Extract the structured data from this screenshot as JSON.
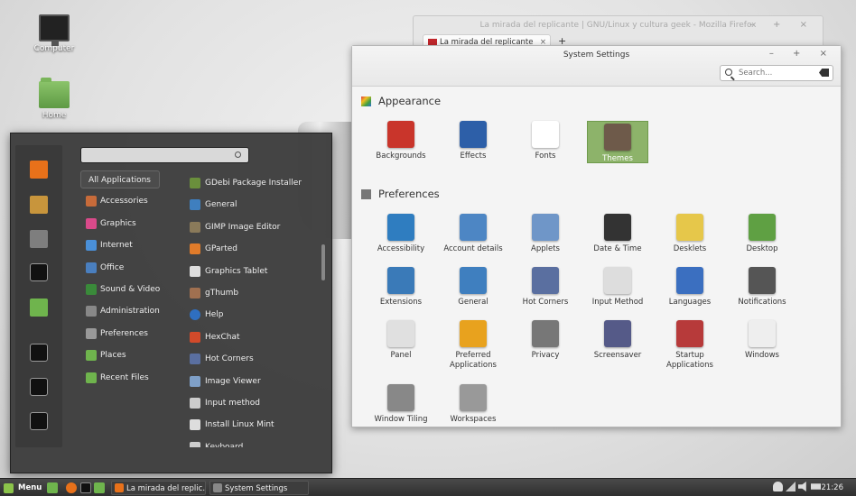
{
  "desktop": {
    "icons": [
      {
        "label": "Computer",
        "icon": "monitor-icon"
      },
      {
        "label": "Home",
        "icon": "home-folder-icon"
      }
    ]
  },
  "firefox": {
    "title": "La mirada del replicante | GNU/Linux y cultura geek - Mozilla Firefox",
    "tab_label": "La mirada del replicante",
    "tab_close": "×",
    "new_tab": "+",
    "controls": "– + ×"
  },
  "settings": {
    "title": "System Settings",
    "controls": "– + ×",
    "search": {
      "placeholder": "Search..."
    },
    "sections": [
      {
        "title": "Appearance",
        "items": [
          {
            "label": "Backgrounds",
            "icon": "backgrounds-icon",
            "color": "#c9352b"
          },
          {
            "label": "Effects",
            "icon": "effects-icon",
            "color": "#2d5fa8"
          },
          {
            "label": "Fonts",
            "icon": "fonts-icon",
            "color": "#ffffff"
          },
          {
            "label": "Themes",
            "icon": "themes-icon",
            "color": "#6e5a4a",
            "selected": true
          }
        ]
      },
      {
        "title": "Preferences",
        "items": [
          {
            "label": "Accessibility",
            "icon": "accessibility-icon",
            "color": "#2f7dc0"
          },
          {
            "label": "Account details",
            "icon": "account-icon",
            "color": "#4d86c4"
          },
          {
            "label": "Applets",
            "icon": "applets-icon",
            "color": "#6f96c8"
          },
          {
            "label": "Date & Time",
            "icon": "clock-icon",
            "color": "#333333"
          },
          {
            "label": "Desklets",
            "icon": "desklets-icon",
            "color": "#e6c74a"
          },
          {
            "label": "Desktop",
            "icon": "desktop-icon",
            "color": "#5fa043"
          },
          {
            "label": "Extensions",
            "icon": "extensions-icon",
            "color": "#3a7ab8"
          },
          {
            "label": "General",
            "icon": "general-icon",
            "color": "#3f7fbf"
          },
          {
            "label": "Hot Corners",
            "icon": "hot-corners-icon",
            "color": "#5a6fa0"
          },
          {
            "label": "Input Method",
            "icon": "keyboard-icon",
            "color": "#dddddd"
          },
          {
            "label": "Languages",
            "icon": "globe-icon",
            "color": "#3b6fc0"
          },
          {
            "label": "Notifications",
            "icon": "notifications-icon",
            "color": "#555555"
          },
          {
            "label": "Panel",
            "icon": "panel-icon",
            "color": "#e0e0e0"
          },
          {
            "label": "Preferred Applications",
            "icon": "star-icon",
            "color": "#e8a21e"
          },
          {
            "label": "Privacy",
            "icon": "privacy-icon",
            "color": "#777777"
          },
          {
            "label": "Screensaver",
            "icon": "lock-icon",
            "color": "#555a88"
          },
          {
            "label": "Startup Applications",
            "icon": "rocket-icon",
            "color": "#b73a3a"
          },
          {
            "label": "Windows",
            "icon": "windows-icon",
            "color": "#eeeeee"
          },
          {
            "label": "Window Tiling",
            "icon": "window-tiling-icon",
            "color": "#888888"
          },
          {
            "label": "Workspaces",
            "icon": "workspaces-icon",
            "color": "#999999"
          }
        ]
      }
    ]
  },
  "menu": {
    "favorites": [
      {
        "icon": "firefox-icon",
        "color": "#e8711a"
      },
      {
        "icon": "software-manager-icon",
        "color": "#c8953c"
      },
      {
        "icon": "system-settings-icon",
        "color": "#7e7e7e"
      },
      {
        "icon": "terminal-icon",
        "color": "#111111"
      },
      {
        "icon": "files-folder-icon",
        "color": "#6fb44d"
      },
      {
        "icon": "lock-screen-icon",
        "color": "#111111"
      },
      {
        "icon": "logout-icon",
        "color": "#111111"
      },
      {
        "icon": "shutdown-icon",
        "color": "#111111"
      }
    ],
    "categories": [
      {
        "label": "All Applications",
        "icon": "",
        "color": ""
      },
      {
        "label": "Accessories",
        "icon": "accessories-icon",
        "color": "#c76b3a"
      },
      {
        "label": "Graphics",
        "icon": "graphics-icon",
        "color": "#d94a8a"
      },
      {
        "label": "Internet",
        "icon": "internet-icon",
        "color": "#4a90d9"
      },
      {
        "label": "Office",
        "icon": "office-icon",
        "color": "#4a7fbf"
      },
      {
        "label": "Sound & Video",
        "icon": "sound-video-icon",
        "color": "#3a8a3a"
      },
      {
        "label": "Administration",
        "icon": "administration-icon",
        "color": "#888888"
      },
      {
        "label": "Preferences",
        "icon": "preferences-icon",
        "color": "#999999"
      },
      {
        "label": "Places",
        "icon": "places-folder-icon",
        "color": "#6fb44d"
      },
      {
        "label": "Recent Files",
        "icon": "recent-folder-icon",
        "color": "#6fb44d"
      }
    ],
    "apps": [
      {
        "label": "GDebi Package Installer",
        "icon": "gdebi-icon",
        "color": "#6a8f3c"
      },
      {
        "label": "General",
        "icon": "general-icon",
        "color": "#3f7fbf"
      },
      {
        "label": "GIMP Image Editor",
        "icon": "gimp-icon",
        "color": "#8a7a5a"
      },
      {
        "label": "GParted",
        "icon": "gparted-icon",
        "color": "#e07b2a"
      },
      {
        "label": "Graphics Tablet",
        "icon": "tablet-icon",
        "color": "#dddddd"
      },
      {
        "label": "gThumb",
        "icon": "gthumb-icon",
        "color": "#a07050"
      },
      {
        "label": "Help",
        "icon": "help-icon",
        "color": "#2f6fc0"
      },
      {
        "label": "HexChat",
        "icon": "hexchat-icon",
        "color": "#d24a2a"
      },
      {
        "label": "Hot Corners",
        "icon": "hot-corners-icon",
        "color": "#5a6fa0"
      },
      {
        "label": "Image Viewer",
        "icon": "image-viewer-icon",
        "color": "#7fa0c8"
      },
      {
        "label": "Input method",
        "icon": "input-method-icon",
        "color": "#cccccc"
      },
      {
        "label": "Install Linux Mint",
        "icon": "install-icon",
        "color": "#dddddd"
      },
      {
        "label": "Keyboard",
        "icon": "keyboard-icon",
        "color": "#cccccc"
      }
    ]
  },
  "taskbar": {
    "menu_label": "Menu",
    "windows": [
      {
        "label": "La mirada del replic...",
        "icon": "firefox-icon",
        "color": "#e8711a"
      },
      {
        "label": "System Settings",
        "icon": "settings-icon",
        "color": "#888888"
      }
    ],
    "clock": "21:26"
  }
}
